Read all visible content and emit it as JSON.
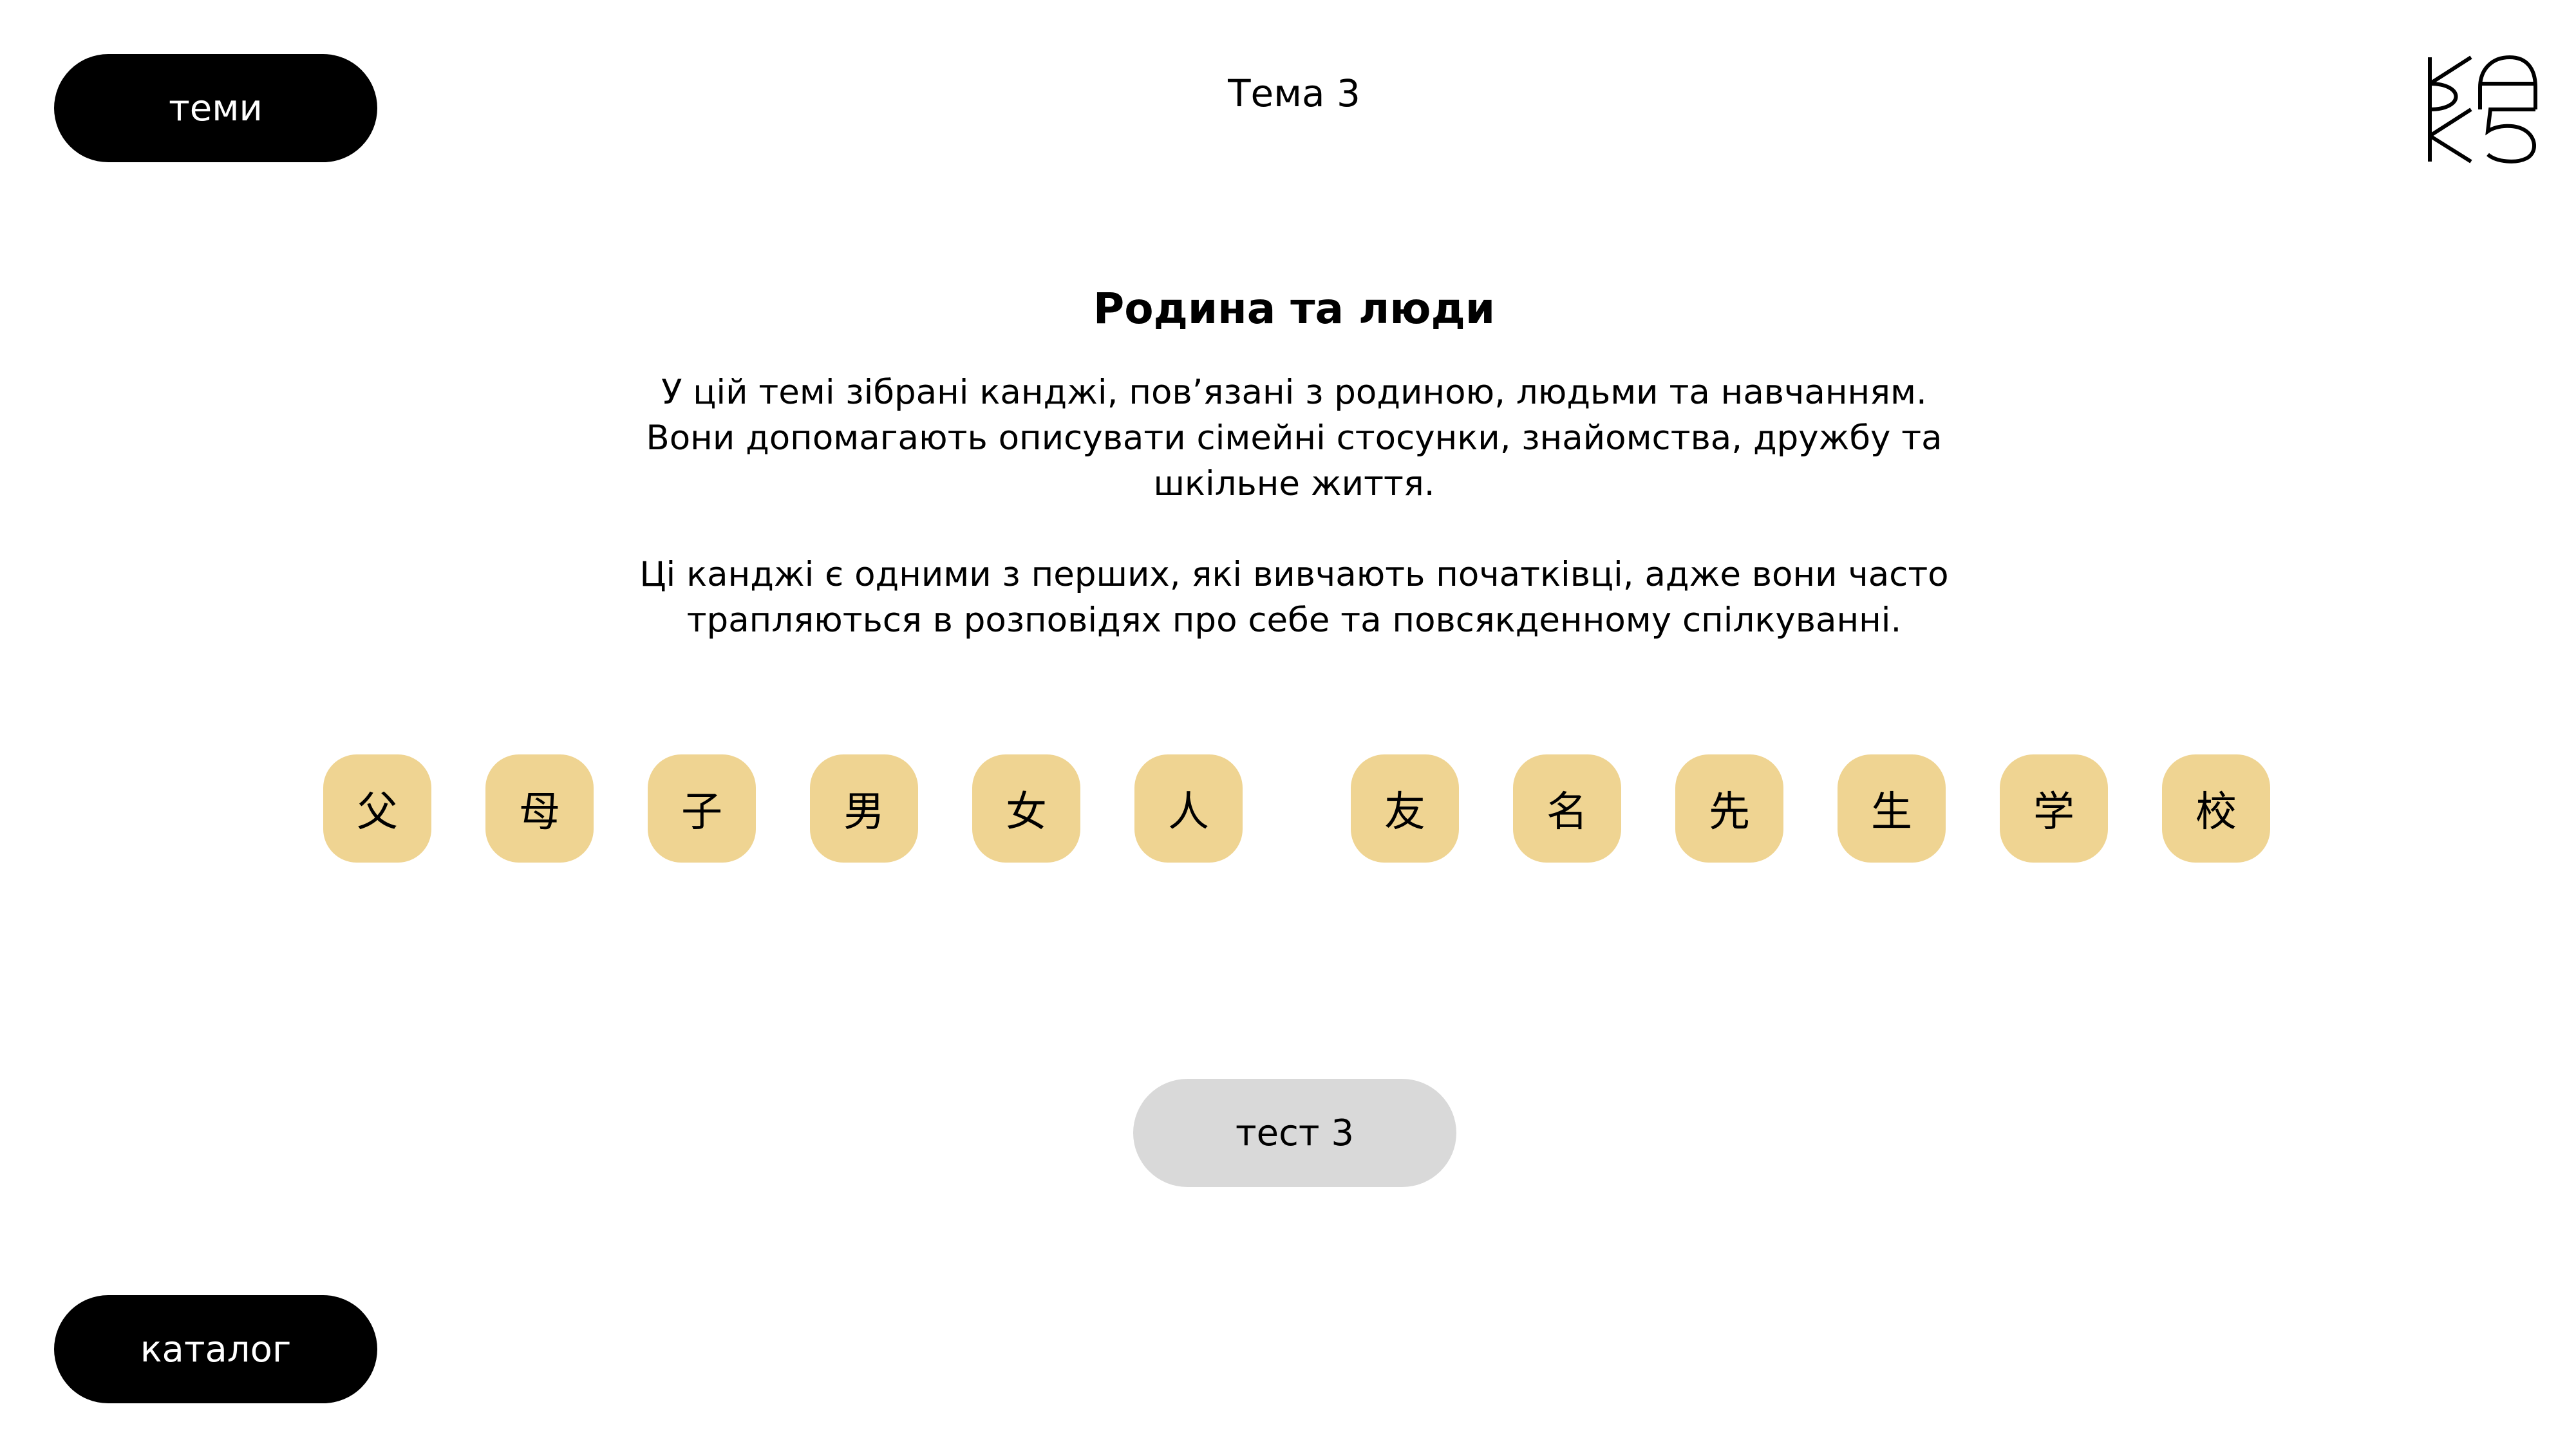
{
  "nav": {
    "topics_label": "теми",
    "catalog_label": "каталог"
  },
  "header": {
    "topic_number": "Тема 3",
    "logo_icon": "kaku-logo-icon"
  },
  "content": {
    "title": "Родина та люди",
    "paragraph_1": "У цій темі зібрані канджі, пов’язані з родиною, людьми та навчанням. Вони допомагають описувати сімейні стосунки, знайомства, дружбу та шкільне життя.",
    "paragraph_2": "Ці канджі є одними з перших, які вивчають початківці, адже вони часто трапляються в розповідях про себе та повсякденному спілкуванні."
  },
  "kanji": [
    "父",
    "母",
    "子",
    "男",
    "女",
    "人",
    "友",
    "名",
    "先",
    "生",
    "学",
    "校"
  ],
  "test": {
    "label": "тест 3"
  },
  "colors": {
    "tile_background": "#efd492",
    "button_dark": "#000000",
    "button_light": "#d9d9d9"
  }
}
